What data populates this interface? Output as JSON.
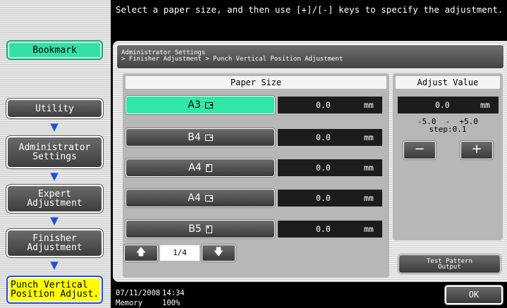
{
  "message": "Select a paper size, and then use [+]/[-] keys to specify the adjustment.",
  "sidebar": {
    "bookmark": "Bookmark",
    "items": [
      {
        "label": "Utility"
      },
      {
        "label": "Administrator\nSettings"
      },
      {
        "label": "Expert\nAdjustment"
      },
      {
        "label": "Finisher\nAdjustment"
      },
      {
        "label": "Punch Vertical\nPosition Adjust."
      }
    ]
  },
  "breadcrumb": "Administrator Settings\n> Finisher Adjustment > Punch Vertical Position Adjustment",
  "paper_size": {
    "header": "Paper Size",
    "rows": [
      {
        "size": "A3",
        "orientation": "landscape",
        "value": "0.0",
        "unit": "mm",
        "selected": true
      },
      {
        "size": "B4",
        "orientation": "landscape",
        "value": "0.0",
        "unit": "mm",
        "selected": false
      },
      {
        "size": "A4",
        "orientation": "portrait",
        "value": "0.0",
        "unit": "mm",
        "selected": false
      },
      {
        "size": "A4",
        "orientation": "landscape",
        "value": "0.0",
        "unit": "mm",
        "selected": false
      },
      {
        "size": "B5",
        "orientation": "portrait",
        "value": "0.0",
        "unit": "mm",
        "selected": false
      }
    ],
    "page_indicator": "1/4"
  },
  "adjust": {
    "header": "Adjust Value",
    "value": "0.0",
    "unit": "mm",
    "range": "-5.0  -  +5.0",
    "step": "step:0.1",
    "minus": "−",
    "plus": "+"
  },
  "test_pattern": "Test Pattern\nOutput",
  "status": {
    "date": "07/11/2008",
    "time": "14:34",
    "memory_label": "Memory",
    "memory_value": "100%"
  },
  "ok": "OK",
  "colors": {
    "selected": "#2fe8a8",
    "current_item": "#ffff00",
    "arrow": "#1c52d8"
  },
  "icons": {
    "up": "arrow-up-icon",
    "down": "arrow-down-icon",
    "paper": "paper-orientation-icon"
  }
}
